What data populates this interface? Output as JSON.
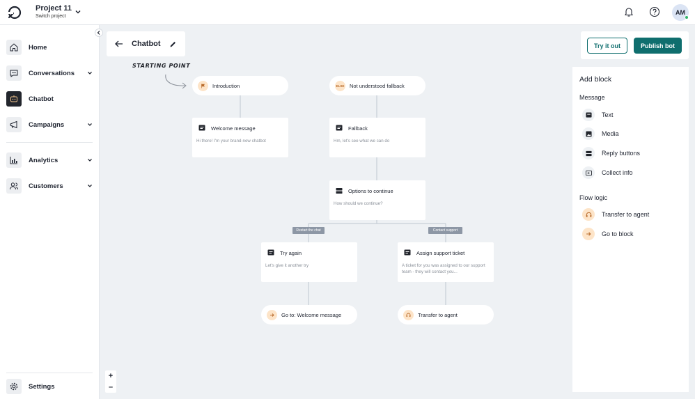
{
  "header": {
    "project_name": "Project 11",
    "project_sub": "Switch project",
    "avatar_initials": "AM"
  },
  "sidebar": {
    "items": [
      {
        "label": "Home",
        "icon": "home-icon"
      },
      {
        "label": "Conversations",
        "icon": "chat-icon"
      },
      {
        "label": "Chatbot",
        "icon": "bot-icon"
      },
      {
        "label": "Campaigns",
        "icon": "megaphone-icon"
      },
      {
        "label": "Analytics",
        "icon": "bar-chart-icon"
      },
      {
        "label": "Customers",
        "icon": "users-icon"
      }
    ],
    "settings": "Settings"
  },
  "page": {
    "title": "Chatbot",
    "try_label": "Try it out",
    "publish_label": "Publish bot"
  },
  "panel": {
    "title": "Add block",
    "message_heading": "Message",
    "message_items": [
      "Text",
      "Media",
      "Reply buttons",
      "Collect info"
    ],
    "flow_heading": "Flow logic",
    "flow_items": [
      "Transfer to agent",
      "Go to block"
    ]
  },
  "flow": {
    "starting_label": "STARTING POINT",
    "intro": "Introduction",
    "fallback_pill": "Not understood fallback",
    "fallback_pill_badge": "ELSE",
    "welcome_title": "Welcome message",
    "welcome_body": "Hi there! I'm your brand-new chatbot",
    "fallback_title": "Fallback",
    "fallback_body": "Hm, let's see what we can do",
    "options_title": "Options to continue",
    "options_body": "How should we continue?",
    "edge_restart": "Restart the chat",
    "edge_support": "Contact support",
    "tryagain_title": "Try again",
    "tryagain_body": "Let's give it another try",
    "ticket_title": "Assign support ticket",
    "ticket_body": "A ticket for you was assigned to our support team - they will contact you...",
    "goto_label": "Go to: Welcome message",
    "transfer_label": "Transfer to agent"
  },
  "zoom": {
    "in": "+",
    "out": "–"
  },
  "colors": {
    "accent": "#0f6e6e",
    "canvas": "#eef1f4",
    "badge": "#fde4c8"
  }
}
